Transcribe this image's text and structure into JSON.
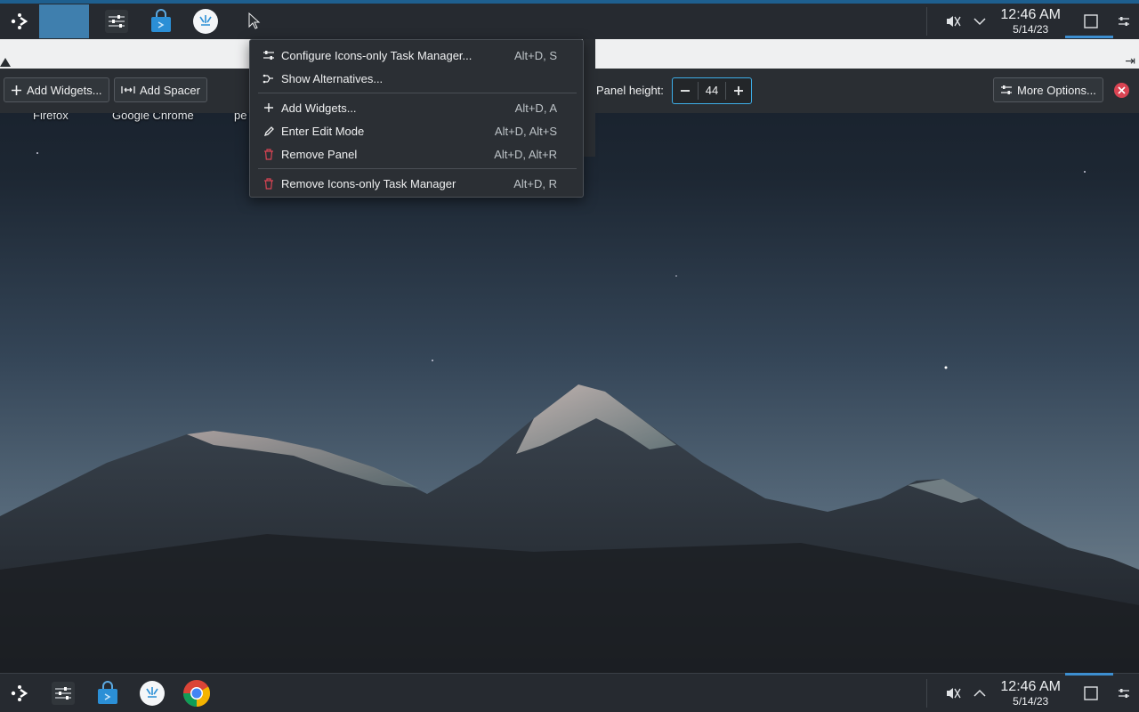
{
  "top_panel": {
    "launcher_icon": "kickoff-launcher-icon",
    "tasks": [
      {
        "name": "active-task",
        "icon": "blank"
      },
      {
        "name": "system-settings",
        "icon": "sliders-icon"
      },
      {
        "name": "discover-store",
        "icon": "store-bag-icon"
      },
      {
        "name": "plasma-app",
        "icon": "kde-logo-icon"
      }
    ],
    "tray": {
      "volume_icon": "muted-speaker-icon",
      "expand_icon": "chevron-down-icon",
      "time": "12:46 AM",
      "date": "5/14/23",
      "show_desktop_icon": "square-icon",
      "config_icon": "sliders-icon"
    }
  },
  "desktop_labels": [
    "Firefox",
    "Google Chrome",
    "pe"
  ],
  "edit_toolbar": {
    "add_widgets": "Add Widgets...",
    "add_spacer": "Add Spacer",
    "panel_height_label": "Panel height:",
    "panel_height_value": "44",
    "more_options": "More Options..."
  },
  "context_menu": {
    "items": [
      {
        "label": "Configure Icons-only Task Manager...",
        "shortcut": "Alt+D, S",
        "icon": "configure-icon"
      },
      {
        "label": "Show Alternatives...",
        "shortcut": "",
        "icon": "alternatives-icon"
      },
      {
        "label": "Add Widgets...",
        "shortcut": "Alt+D, A",
        "icon": "plus-icon"
      },
      {
        "label": "Enter Edit Mode",
        "shortcut": "Alt+D, Alt+S",
        "icon": "pencil-icon"
      },
      {
        "label": "Remove Panel",
        "shortcut": "Alt+D, Alt+R",
        "icon": "trash-icon"
      },
      {
        "label": "Remove Icons-only Task Manager",
        "shortcut": "Alt+D, R",
        "icon": "trash-icon"
      }
    ]
  },
  "bottom_panel": {
    "tasks": [
      {
        "name": "system-settings",
        "icon": "sliders-icon"
      },
      {
        "name": "discover-store",
        "icon": "store-bag-icon"
      },
      {
        "name": "plasma-app",
        "icon": "kde-logo-icon"
      },
      {
        "name": "google-chrome",
        "icon": "chrome-icon"
      }
    ],
    "tray": {
      "volume_icon": "muted-speaker-icon",
      "expand_icon": "chevron-up-icon",
      "time": "12:46 AM",
      "date": "5/14/23"
    }
  },
  "colors": {
    "accent": "#3daee9",
    "panel": "#262a30",
    "danger": "#da4453"
  }
}
